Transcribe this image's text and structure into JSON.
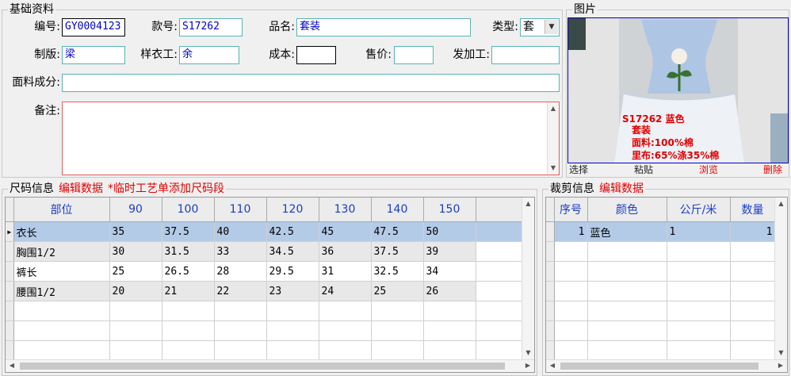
{
  "basic": {
    "legend": "基础资料",
    "labels": {
      "code": "编号:",
      "style": "款号:",
      "name": "品名:",
      "type": "类型:",
      "pattern": "制版:",
      "sample": "样衣工:",
      "cost": "成本:",
      "price": "售价:",
      "processor": "发加工:",
      "fabric": "面料成分:",
      "remark": "备注:"
    },
    "values": {
      "code": "GY0004123",
      "style": "S17262",
      "name": "套装",
      "type": "套",
      "pattern": "梁",
      "sample": "余",
      "cost": "",
      "price": "",
      "processor": "",
      "fabric": "",
      "remark": ""
    }
  },
  "photo": {
    "legend": "图片",
    "caption": [
      "S17262 蓝色",
      "套装",
      "面料:100%棉",
      "里布:65%涤35%棉"
    ],
    "actions": {
      "select": "选择",
      "paste": "粘贴",
      "browse": "浏览",
      "delete": "删除"
    }
  },
  "size": {
    "legend": "尺码信息",
    "edit": "编辑数据",
    "note": "*临时工艺单添加尺码段",
    "columns": [
      "部位",
      "90",
      "100",
      "110",
      "120",
      "130",
      "140",
      "150"
    ],
    "rows": [
      [
        "衣长",
        "35",
        "37.5",
        "40",
        "42.5",
        "45",
        "47.5",
        "50"
      ],
      [
        "胸围1/2",
        "30",
        "31.5",
        "33",
        "34.5",
        "36",
        "37.5",
        "39"
      ],
      [
        "裤长",
        "25",
        "26.5",
        "28",
        "29.5",
        "31",
        "32.5",
        "34"
      ],
      [
        "腰围1/2",
        "20",
        "21",
        "22",
        "23",
        "24",
        "25",
        "26"
      ]
    ]
  },
  "cut": {
    "legend": "裁剪信息",
    "edit": "编辑数据",
    "columns": [
      "序号",
      "颜色",
      "公斤/米",
      "数量"
    ],
    "rows": [
      [
        "1",
        "蓝色",
        "1",
        "1"
      ]
    ]
  },
  "colors": {
    "accent_red": "#e00000",
    "header_blue": "#1a3cc8",
    "selection": "#b4cbe8"
  }
}
